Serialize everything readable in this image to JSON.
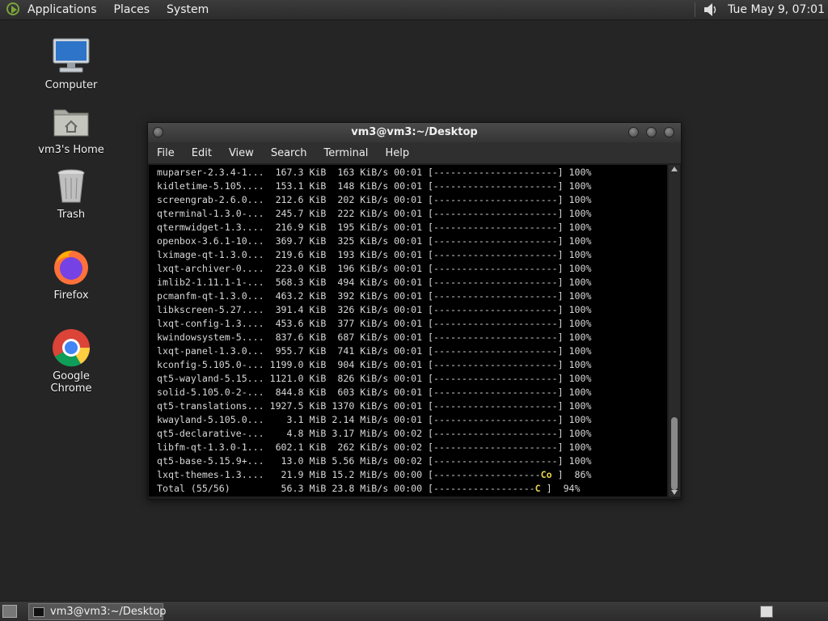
{
  "top_panel": {
    "menus": [
      "Applications",
      "Places",
      "System"
    ],
    "clock": "Tue May  9, 07:01",
    "logo_icon": "distro-menu-icon",
    "volume_icon": "speaker-icon"
  },
  "desktop_icons": [
    {
      "label": "Computer",
      "icon": "monitor-icon"
    },
    {
      "label": "vm3's Home",
      "icon": "home-folder-icon"
    },
    {
      "label": "Trash",
      "icon": "trash-icon"
    },
    {
      "label": "Firefox",
      "icon": "firefox-icon"
    },
    {
      "label": "Google Chrome",
      "icon": "chrome-icon"
    }
  ],
  "window": {
    "title": "vm3@vm3:~/Desktop",
    "menu": [
      "File",
      "Edit",
      "View",
      "Search",
      "Terminal",
      "Help"
    ]
  },
  "terminal": {
    "rows": [
      {
        "name": "muparser-2.3.4-1...",
        "size": "167.3 KiB",
        "rate": "163 KiB/s",
        "time": "00:01",
        "bar": "[----------------------]",
        "pct": "100%"
      },
      {
        "name": "kidletime-5.105....",
        "size": "153.1 KiB",
        "rate": "148 KiB/s",
        "time": "00:01",
        "bar": "[----------------------]",
        "pct": "100%"
      },
      {
        "name": "screengrab-2.6.0...",
        "size": "212.6 KiB",
        "rate": "202 KiB/s",
        "time": "00:01",
        "bar": "[----------------------]",
        "pct": "100%"
      },
      {
        "name": "qterminal-1.3.0-...",
        "size": "245.7 KiB",
        "rate": "222 KiB/s",
        "time": "00:01",
        "bar": "[----------------------]",
        "pct": "100%"
      },
      {
        "name": "qtermwidget-1.3....",
        "size": "216.9 KiB",
        "rate": "195 KiB/s",
        "time": "00:01",
        "bar": "[----------------------]",
        "pct": "100%"
      },
      {
        "name": "openbox-3.6.1-10...",
        "size": "369.7 KiB",
        "rate": "325 KiB/s",
        "time": "00:01",
        "bar": "[----------------------]",
        "pct": "100%"
      },
      {
        "name": "lximage-qt-1.3.0...",
        "size": "219.6 KiB",
        "rate": "193 KiB/s",
        "time": "00:01",
        "bar": "[----------------------]",
        "pct": "100%"
      },
      {
        "name": "lxqt-archiver-0....",
        "size": "223.0 KiB",
        "rate": "196 KiB/s",
        "time": "00:01",
        "bar": "[----------------------]",
        "pct": "100%"
      },
      {
        "name": "imlib2-1.11.1-1-...",
        "size": "568.3 KiB",
        "rate": "494 KiB/s",
        "time": "00:01",
        "bar": "[----------------------]",
        "pct": "100%"
      },
      {
        "name": "pcmanfm-qt-1.3.0...",
        "size": "463.2 KiB",
        "rate": "392 KiB/s",
        "time": "00:01",
        "bar": "[----------------------]",
        "pct": "100%"
      },
      {
        "name": "libkscreen-5.27....",
        "size": "391.4 KiB",
        "rate": "326 KiB/s",
        "time": "00:01",
        "bar": "[----------------------]",
        "pct": "100%"
      },
      {
        "name": "lxqt-config-1.3....",
        "size": "453.6 KiB",
        "rate": "377 KiB/s",
        "time": "00:01",
        "bar": "[----------------------]",
        "pct": "100%"
      },
      {
        "name": "kwindowsystem-5....",
        "size": "837.6 KiB",
        "rate": "687 KiB/s",
        "time": "00:01",
        "bar": "[----------------------]",
        "pct": "100%"
      },
      {
        "name": "lxqt-panel-1.3.0...",
        "size": "955.7 KiB",
        "rate": "741 KiB/s",
        "time": "00:01",
        "bar": "[----------------------]",
        "pct": "100%"
      },
      {
        "name": "kconfig-5.105.0-...",
        "size": "1199.0 KiB",
        "rate": "904 KiB/s",
        "time": "00:01",
        "bar": "[----------------------]",
        "pct": "100%"
      },
      {
        "name": "qt5-wayland-5.15...",
        "size": "1121.0 KiB",
        "rate": "826 KiB/s",
        "time": "00:01",
        "bar": "[----------------------]",
        "pct": "100%"
      },
      {
        "name": "solid-5.105.0-2-...",
        "size": "844.8 KiB",
        "rate": "603 KiB/s",
        "time": "00:01",
        "bar": "[----------------------]",
        "pct": "100%"
      },
      {
        "name": "qt5-translations...",
        "size": "1927.5 KiB",
        "rate": "1370 KiB/s",
        "time": "00:01",
        "bar": "[----------------------]",
        "pct": "100%"
      },
      {
        "name": "kwayland-5.105.0...",
        "size": "3.1 MiB",
        "rate": "2.14 MiB/s",
        "time": "00:01",
        "bar": "[----------------------]",
        "pct": "100%"
      },
      {
        "name": "qt5-declarative-...",
        "size": "4.8 MiB",
        "rate": "3.17 MiB/s",
        "time": "00:02",
        "bar": "[----------------------]",
        "pct": "100%"
      },
      {
        "name": "libfm-qt-1.3.0-1...",
        "size": "602.1 KiB",
        "rate": "262 KiB/s",
        "time": "00:02",
        "bar": "[----------------------]",
        "pct": "100%"
      },
      {
        "name": "qt5-base-5.15.9+...",
        "size": "13.0 MiB",
        "rate": "5.56 MiB/s",
        "time": "00:02",
        "bar": "[----------------------]",
        "pct": "100%"
      },
      {
        "name": "lxqt-themes-1.3....",
        "size": "21.9 MiB",
        "rate": "15.2 MiB/s",
        "time": "00:00",
        "bar_pre": "[-------------------",
        "pac": "Co",
        "bar_post": " ]",
        "pct": " 86%"
      },
      {
        "name": "Total (55/56)      ",
        "size": "56.3 MiB",
        "rate": "23.8 MiB/s",
        "time": "00:00",
        "bar_pre": "[------------------",
        "pac": "C",
        "bar_post": " ]",
        "pct": " 94%"
      }
    ]
  },
  "taskbar": {
    "task_label": "vm3@vm3:~/Desktop"
  }
}
